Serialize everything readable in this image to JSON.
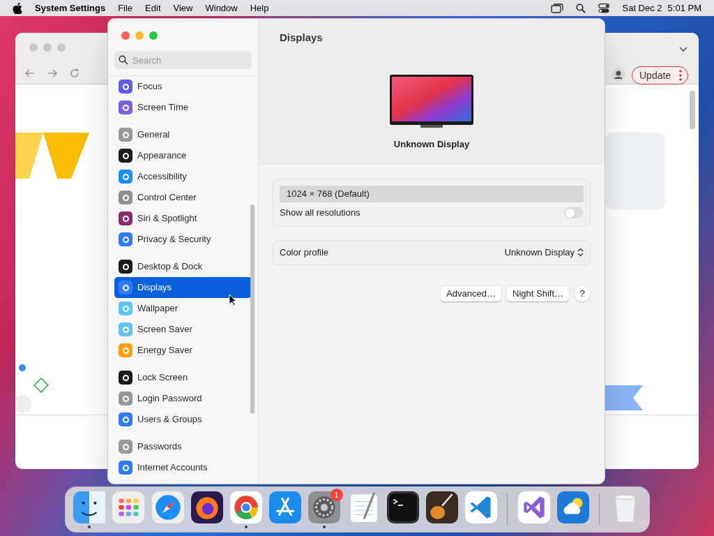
{
  "menu_bar": {
    "app_name": "System Settings",
    "menus": [
      "File",
      "Edit",
      "View",
      "Window",
      "Help"
    ],
    "date": "Sat Dec 2",
    "time": "5:01 PM"
  },
  "background_window": {
    "update_button": "Update"
  },
  "sidebar": {
    "search": {
      "placeholder": "Search"
    },
    "groups": [
      {
        "items": [
          {
            "label": "Focus",
            "color": "#5e5ce6",
            "selected": false
          },
          {
            "label": "Screen Time",
            "color": "#7d5fd6",
            "selected": false
          }
        ]
      },
      {
        "items": [
          {
            "label": "General",
            "color": "#9a9a9e",
            "selected": false
          },
          {
            "label": "Appearance",
            "color": "#1c1c1e",
            "selected": false
          },
          {
            "label": "Accessibility",
            "color": "#1f8ef1",
            "selected": false
          },
          {
            "label": "Control Center",
            "color": "#8e8e93",
            "selected": false
          },
          {
            "label": "Siri & Spotlight",
            "color": "#8a2a6a",
            "selected": false
          },
          {
            "label": "Privacy & Security",
            "color": "#2f7cf6",
            "selected": false
          }
        ]
      },
      {
        "items": [
          {
            "label": "Desktop & Dock",
            "color": "#1c1c1e",
            "selected": false
          },
          {
            "label": "Displays",
            "color": "#2f7cf6",
            "selected": true
          },
          {
            "label": "Wallpaper",
            "color": "#5ac8fa",
            "selected": false
          },
          {
            "label": "Screen Saver",
            "color": "#64c3f0",
            "selected": false
          },
          {
            "label": "Energy Saver",
            "color": "#ff9f0a",
            "selected": false
          }
        ]
      },
      {
        "items": [
          {
            "label": "Lock Screen",
            "color": "#1c1c1e",
            "selected": false
          },
          {
            "label": "Login Password",
            "color": "#98989d",
            "selected": false
          },
          {
            "label": "Users & Groups",
            "color": "#2f7cf6",
            "selected": false
          }
        ]
      },
      {
        "items": [
          {
            "label": "Passwords",
            "color": "#98989d",
            "selected": false
          },
          {
            "label": "Internet Accounts",
            "color": "#2f7cf6",
            "selected": false
          }
        ]
      }
    ]
  },
  "content": {
    "title": "Displays",
    "display_name": "Unknown Display",
    "resolutions": [
      {
        "label": "1024 × 768 (Default)",
        "selected": true
      }
    ],
    "show_all_resolutions": {
      "label": "Show all resolutions",
      "on": false
    },
    "color_profile": {
      "label": "Color profile",
      "value": "Unknown Display"
    },
    "buttons": [
      "Advanced…",
      "Night Shift…"
    ],
    "help": "?"
  },
  "dock": {
    "sections": [
      [
        {
          "kind": "finder",
          "running": true
        },
        {
          "kind": "launchpad",
          "running": false
        },
        {
          "kind": "safari",
          "running": false
        },
        {
          "kind": "firefox",
          "running": false
        },
        {
          "kind": "chrome",
          "running": true
        },
        {
          "kind": "appstore",
          "running": false
        },
        {
          "kind": "settings",
          "running": true,
          "badge": "1"
        },
        {
          "kind": "textedit",
          "running": false
        },
        {
          "kind": "terminal",
          "running": false
        },
        {
          "kind": "guitar",
          "running": false
        },
        {
          "kind": "vscode",
          "running": false
        }
      ],
      [
        {
          "kind": "visualstudio",
          "running": false
        },
        {
          "kind": "weather",
          "running": false
        }
      ],
      [
        {
          "kind": "trash",
          "running": false
        }
      ]
    ]
  }
}
